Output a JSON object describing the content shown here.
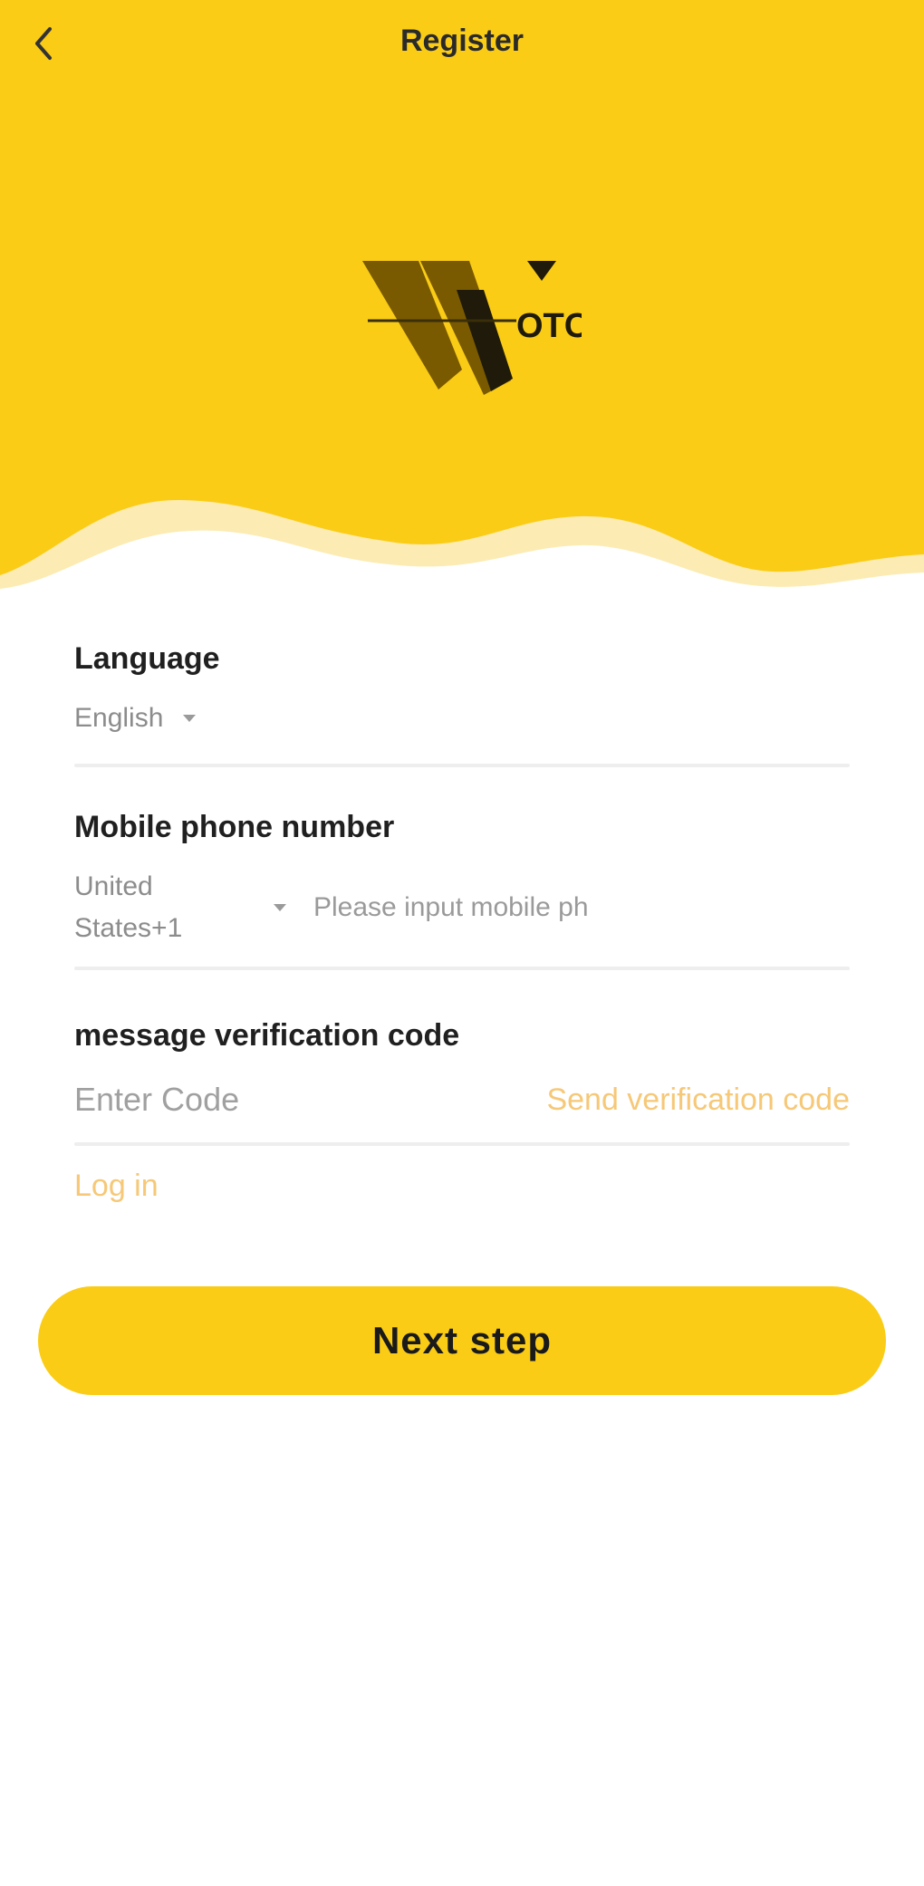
{
  "header": {
    "title": "Register",
    "back_icon": "chevron-left-icon"
  },
  "logo": {
    "brand_text": "OTC"
  },
  "form": {
    "language": {
      "label": "Language",
      "value": "English"
    },
    "phone": {
      "label": "Mobile phone number",
      "country_line1": "United",
      "country_line2": "States+1",
      "placeholder": "Please input mobile ph"
    },
    "code": {
      "label": "message verification code",
      "placeholder": "Enter Code",
      "send_label": "Send verification code"
    },
    "login_label": "Log in"
  },
  "actions": {
    "next_label": "Next step"
  },
  "colors": {
    "brand_yellow": "#FACC15",
    "wave_light": "#FCEBB2",
    "link_orange": "#F6C877"
  }
}
